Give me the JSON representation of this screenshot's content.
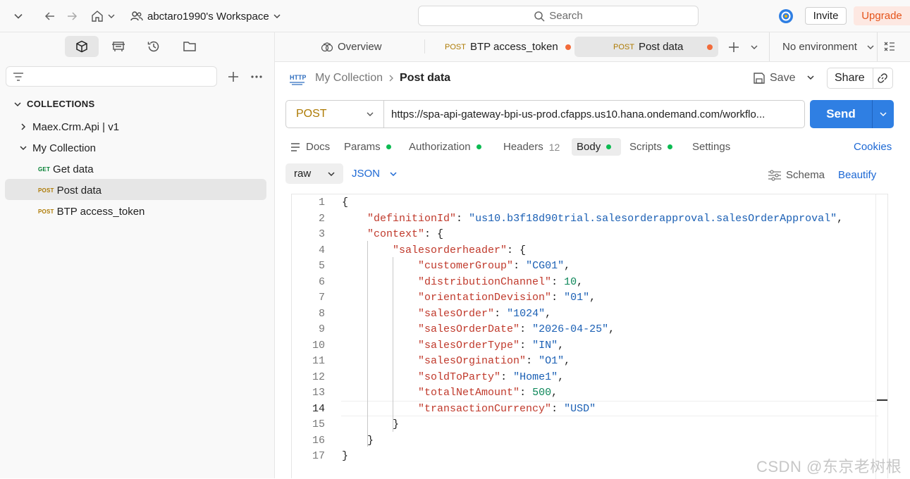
{
  "topbar": {
    "workspace": "abctaro1990's Workspace",
    "search_placeholder": "Search",
    "invite_label": "Invite",
    "upgrade_label": "Upgrade"
  },
  "sidebar": {
    "section_title": "COLLECTIONS",
    "items": [
      {
        "label": "Maex.Crm.Api | v1",
        "type": "collection",
        "expanded": false
      },
      {
        "label": "My Collection",
        "type": "collection",
        "expanded": true
      },
      {
        "label": "Get data",
        "method": "GET"
      },
      {
        "label": "Post data",
        "method": "POST",
        "selected": true
      },
      {
        "label": "BTP access_token",
        "method": "POST"
      }
    ]
  },
  "tabs": {
    "overview": "Overview",
    "items": [
      {
        "method": "POST",
        "label": "BTP access_token",
        "unsaved": true
      },
      {
        "method": "POST",
        "label": "Post data",
        "unsaved": true,
        "active": true
      }
    ],
    "environment": "No environment"
  },
  "breadcrumb": {
    "protocol_icon": "HTTP",
    "collection": "My Collection",
    "request": "Post data"
  },
  "actions": {
    "save": "Save",
    "share": "Share"
  },
  "request": {
    "method": "POST",
    "url": "https://spa-api-gateway-bpi-us-prod.cfapps.us10.hana.ondemand.com/workflo...",
    "send": "Send"
  },
  "request_tabs": {
    "docs": "Docs",
    "params": "Params",
    "authorization": "Authorization",
    "headers": "Headers",
    "headers_count": "12",
    "body": "Body",
    "scripts": "Scripts",
    "settings": "Settings",
    "cookies": "Cookies"
  },
  "body": {
    "mode": "raw",
    "language": "JSON",
    "schema": "Schema",
    "beautify": "Beautify"
  },
  "editor": {
    "current_line": 14,
    "lines": [
      {
        "n": "1",
        "t": "{"
      },
      {
        "n": "2",
        "t": "    \"definitionId\": \"us10.b3f18d90trial.salesorderapproval.salesOrderApproval\","
      },
      {
        "n": "3",
        "t": "    \"context\": {"
      },
      {
        "n": "4",
        "t": "        \"salesorderheader\": {"
      },
      {
        "n": "5",
        "t": "            \"customerGroup\": \"CG01\","
      },
      {
        "n": "6",
        "t": "            \"distributionChannel\": 10,"
      },
      {
        "n": "7",
        "t": "            \"orientationDevision\": \"01\","
      },
      {
        "n": "8",
        "t": "            \"salesOrder\": \"1024\","
      },
      {
        "n": "9",
        "t": "            \"salesOrderDate\": \"2026-04-25\","
      },
      {
        "n": "10",
        "t": "            \"salesOrderType\": \"IN\","
      },
      {
        "n": "11",
        "t": "            \"salesOrgination\": \"O1\","
      },
      {
        "n": "12",
        "t": "            \"soldToParty\": \"Home1\","
      },
      {
        "n": "13",
        "t": "            \"totalNetAmount\": 500,"
      },
      {
        "n": "14",
        "t": "            \"transactionCurrency\": \"USD\""
      },
      {
        "n": "15",
        "t": "        }"
      },
      {
        "n": "16",
        "t": "    }"
      },
      {
        "n": "17",
        "t": "}"
      }
    ]
  },
  "watermark": "CSDN @东京老树根",
  "colors": {
    "accent": "#2f7fe3",
    "post": "#ad7a03",
    "get": "#007f31",
    "upgrade": "#e5531a",
    "dirty_dot": "#f26b3a",
    "active_dot": "#0cbb52"
  }
}
